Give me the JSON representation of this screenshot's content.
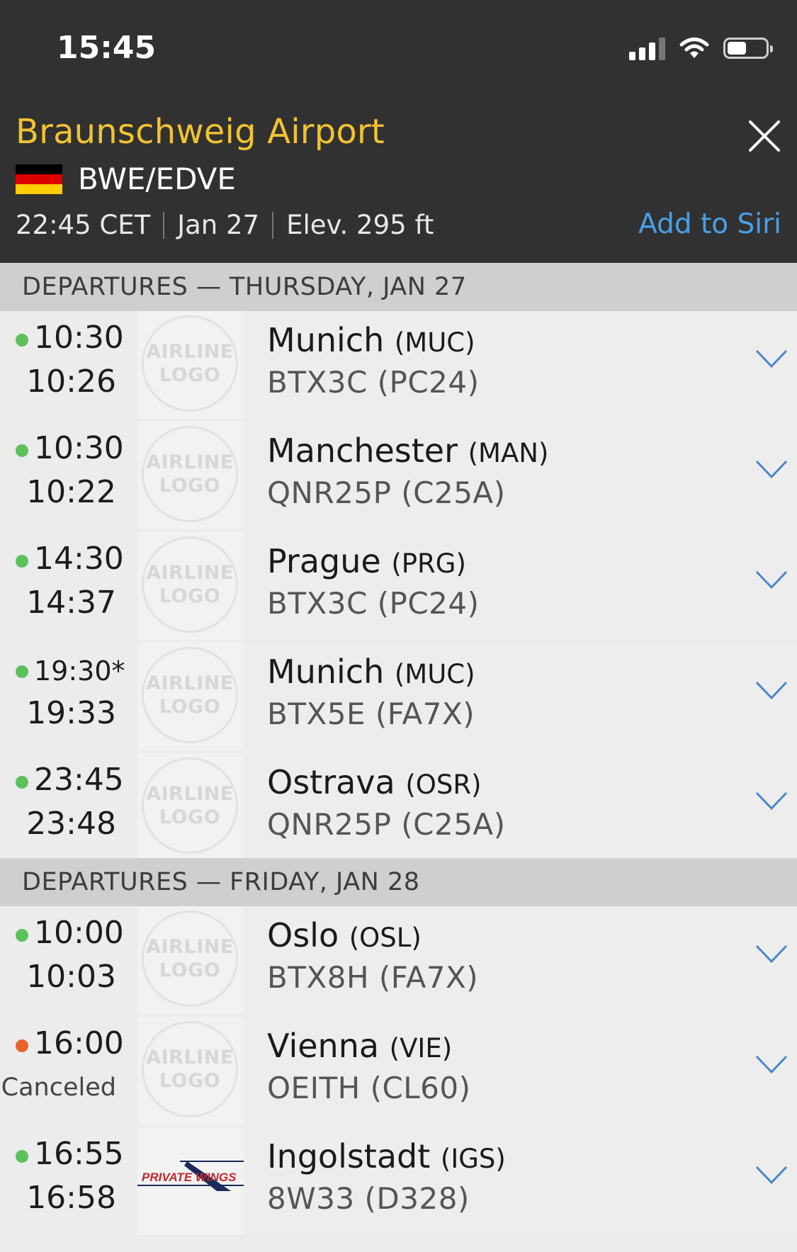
{
  "status_bar": {
    "time": "15:45"
  },
  "header": {
    "airport_name": "Braunschweig Airport",
    "codes": "BWE/EDVE",
    "local_time": "22:45 CET",
    "date": "Jan 27",
    "elevation": "Elev. 295 ft",
    "add_to_siri": "Add to Siri",
    "flag_colors": [
      "#000000",
      "#dd0000",
      "#ffce00"
    ]
  },
  "logo_placeholder": {
    "line1": "AIRLINE",
    "line2": "LOGO"
  },
  "colors": {
    "on_time": "#5cc15c",
    "canceled": "#e8632c",
    "accent": "#4a9fe8",
    "title": "#f1c232"
  },
  "sections": [
    {
      "title": "DEPARTURES — THURSDAY, JAN 27",
      "flights": [
        {
          "scheduled": "10:30",
          "actual": "10:26",
          "destination": "Munich",
          "code": "(MUC)",
          "flight": "BTX3C (PC24)",
          "status": "on_time"
        },
        {
          "scheduled": "10:30",
          "actual": "10:22",
          "destination": "Manchester",
          "code": "(MAN)",
          "flight": "QNR25P (C25A)",
          "status": "on_time"
        },
        {
          "scheduled": "14:30",
          "actual": "14:37",
          "destination": "Prague",
          "code": "(PRG)",
          "flight": "BTX3C (PC24)",
          "status": "on_time"
        },
        {
          "scheduled": "19:30*",
          "actual": "19:33",
          "destination": "Munich",
          "code": "(MUC)",
          "flight": "BTX5E (FA7X)",
          "status": "on_time"
        },
        {
          "scheduled": "23:45",
          "actual": "23:48",
          "destination": "Ostrava",
          "code": "(OSR)",
          "flight": "QNR25P (C25A)",
          "status": "on_time"
        }
      ]
    },
    {
      "title": "DEPARTURES — FRIDAY, JAN 28",
      "flights": [
        {
          "scheduled": "10:00",
          "actual": "10:03",
          "destination": "Oslo",
          "code": "(OSL)",
          "flight": "BTX8H (FA7X)",
          "status": "on_time"
        },
        {
          "scheduled": "16:00",
          "actual": "Canceled",
          "destination": "Vienna",
          "code": "(VIE)",
          "flight": "OEITH (CL60)",
          "status": "canceled"
        },
        {
          "scheduled": "16:55",
          "actual": "16:58",
          "destination": "Ingolstadt",
          "code": "(IGS)",
          "flight": "8W33 (D328)",
          "status": "on_time",
          "airline_logo": "PRIVATE WINGS"
        }
      ]
    }
  ]
}
